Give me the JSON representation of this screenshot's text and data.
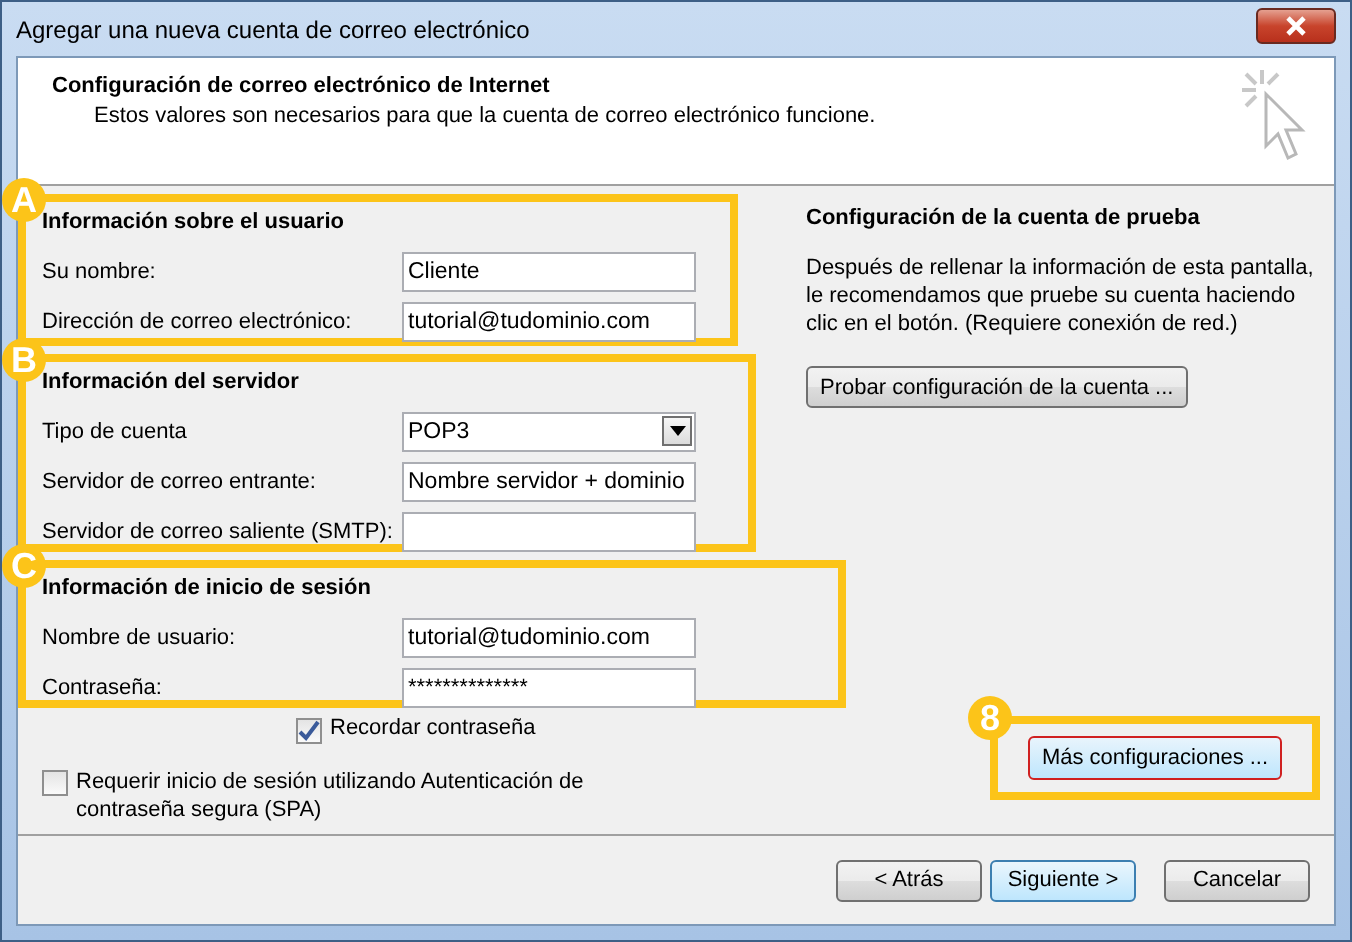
{
  "window": {
    "title": "Agregar una nueva cuenta de correo electrónico"
  },
  "header": {
    "title": "Configuración de correo electrónico de Internet",
    "subtitle": "Estos valores son necesarios para que la cuenta de correo electrónico funcione."
  },
  "sections": [
    {
      "badge": "A",
      "heading": "Información sobre el usuario",
      "fields": [
        {
          "label": "Su nombre:",
          "kind": "text",
          "value": "Cliente"
        },
        {
          "label": "Dirección de correo electrónico:",
          "kind": "text",
          "value": "tutorial@tudominio.com"
        }
      ]
    },
    {
      "badge": "B",
      "heading": "Información del servidor",
      "fields": [
        {
          "label": "Tipo de cuenta",
          "kind": "dropdown",
          "value": "POP3"
        },
        {
          "label": "Servidor de correo entrante:",
          "kind": "text",
          "value": "Nombre servidor + dominio"
        },
        {
          "label": "Servidor de correo saliente (SMTP):",
          "kind": "text"
        }
      ]
    },
    {
      "badge": "C",
      "heading": "Información de inicio de sesión",
      "fields": [
        {
          "label": "Nombre de usuario:",
          "kind": "text",
          "value": "tutorial@tudominio.com"
        },
        {
          "label": "Contraseña:",
          "kind": "password",
          "value": "**************"
        }
      ]
    }
  ],
  "remember_password": {
    "label": "Recordar contraseña",
    "checked": true
  },
  "spa": {
    "label": "Requerir inicio de sesión utilizando Autenticación de contraseña segura (SPA)",
    "checked": false
  },
  "test_panel": {
    "heading": "Configuración de la cuenta de prueba",
    "text": "Después de rellenar la información de esta pantalla, le recomendamos que pruebe su cuenta haciendo clic en el botón. (Requiere conexión de red.)",
    "button": "Probar configuración de la cuenta ..."
  },
  "more_settings": {
    "badge": "8",
    "button": "Más configuraciones ..."
  },
  "buttons": [
    {
      "label": "< Atrás",
      "default": false
    },
    {
      "label": "Siguiente >",
      "default": true
    },
    {
      "label": "Cancelar",
      "default": false
    }
  ]
}
